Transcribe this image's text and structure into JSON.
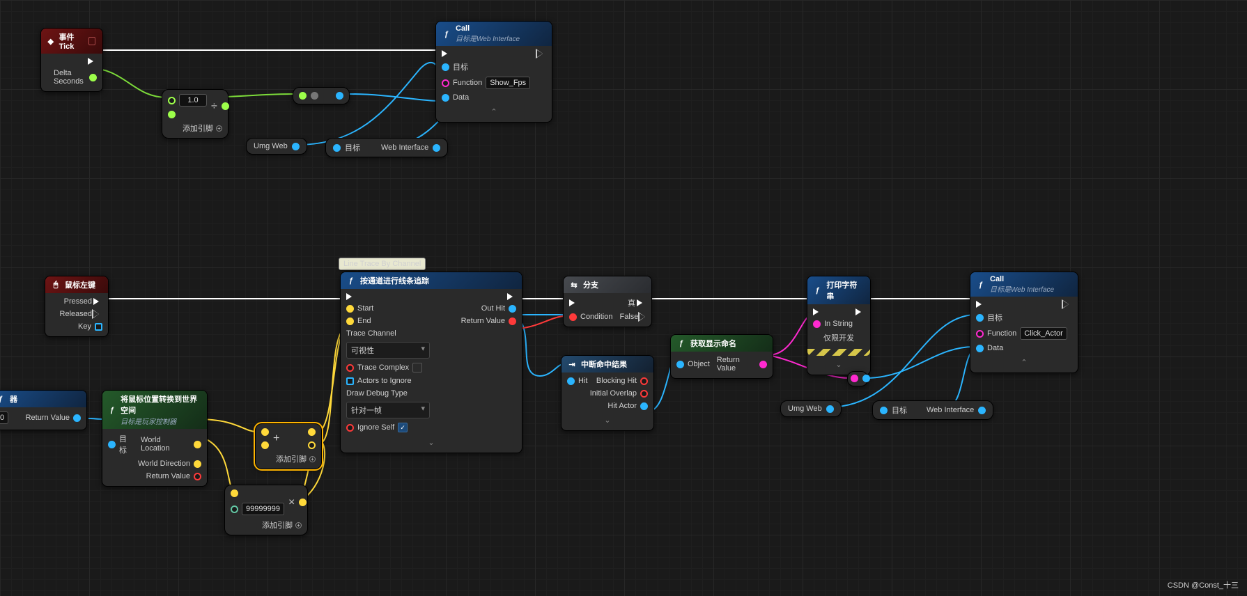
{
  "watermark": "CSDN @Const_十三",
  "common": {
    "addPin": "添加引脚"
  },
  "tooltip": {
    "lineTrace": "Line Trace By Channel"
  },
  "vars": {
    "umgWeb": "Umg Web",
    "target": "目标",
    "webInterface": "Web Interface"
  },
  "nodes": {
    "eventTick": {
      "title": "事件Tick",
      "pins": {
        "deltaSeconds": "Delta Seconds"
      }
    },
    "divide": {
      "op": "÷",
      "valA": "1.0"
    },
    "callTop": {
      "title": "Call",
      "subtitle": "目标是Web Interface",
      "functionValue": "Show_Fps",
      "pins": {
        "target": "目标",
        "function": "Function",
        "data": "Data"
      }
    },
    "mouse": {
      "title": "鼠标左键",
      "pins": {
        "pressed": "Pressed",
        "released": "Released",
        "key": "Key"
      }
    },
    "pcPartial": {
      "title": "器",
      "idx": "0",
      "pins": {
        "returnValue": "Return Value"
      }
    },
    "convertMouse": {
      "title": "将鼠标位置转换到世界空间",
      "subtitle": "目标是玩家控制器",
      "pins": {
        "target": "目标",
        "worldLocation": "World Location",
        "worldDirection": "World Direction",
        "returnValue": "Return Value"
      }
    },
    "lineTrace": {
      "title": "按通道进行线条追踪",
      "traceChannelValue": "可视性",
      "drawDebugValue": "针对一帧",
      "pins": {
        "start": "Start",
        "end": "End",
        "outHit": "Out Hit",
        "returnValue": "Return Value",
        "traceChannel": "Trace Channel",
        "traceComplex": "Trace Complex",
        "actorsToIgnore": "Actors to Ignore",
        "drawDebugType": "Draw Debug Type",
        "ignoreSelf": "Ignore Self"
      }
    },
    "branch": {
      "title": "分支",
      "pins": {
        "condition": "Condition",
        "true": "真",
        "false": "False"
      }
    },
    "breakHit": {
      "title": "中断命中结果",
      "pins": {
        "hit": "Hit",
        "blockingHit": "Blocking Hit",
        "initialOverlap": "Initial Overlap",
        "hitActor": "Hit Actor"
      }
    },
    "getName": {
      "title": "获取显示命名",
      "pins": {
        "object": "Object",
        "returnValue": "Return Value"
      }
    },
    "print": {
      "title": "打印字符串",
      "devOnly": "仅限开发",
      "pins": {
        "inString": "In String"
      }
    },
    "callRight": {
      "title": "Call",
      "subtitle": "目标是Web Interface",
      "functionValue": "Click_Actor",
      "pins": {
        "target": "目标",
        "function": "Function",
        "data": "Data"
      }
    },
    "add": {
      "op": "+"
    },
    "mul": {
      "op": "×",
      "valB": "99999999"
    }
  }
}
